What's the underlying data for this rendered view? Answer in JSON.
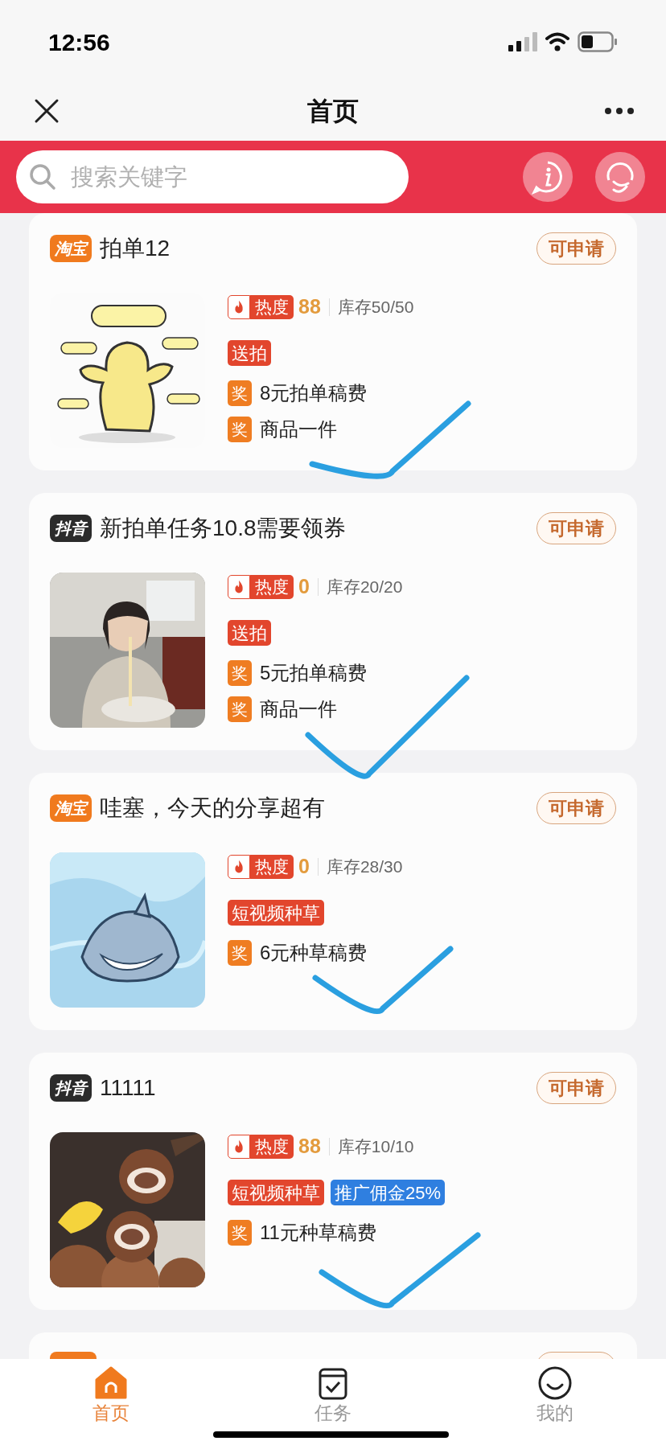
{
  "status_bar": {
    "time": "12:56"
  },
  "nav_bar": {
    "title": "首页"
  },
  "search": {
    "placeholder": "搜索关键字"
  },
  "tasks": [
    {
      "kind": "taobao",
      "platform_label": "淘宝",
      "title": "拍单12",
      "action": "可申请",
      "heat_label": "热度",
      "heat": "88",
      "stock": "库存50/50",
      "tags": [
        {
          "text": "送拍",
          "color": "#e2462d"
        }
      ],
      "rewards": [
        {
          "badge": "奖",
          "text": "8元拍单稿费"
        },
        {
          "badge": "奖",
          "text": "商品一件"
        }
      ]
    },
    {
      "kind": "douyin",
      "platform_label": "抖音",
      "title": "新拍单任务10.8需要领券",
      "action": "可申请",
      "heat_label": "热度",
      "heat": "0",
      "stock": "库存20/20",
      "tags": [
        {
          "text": "送拍",
          "color": "#e2462d"
        }
      ],
      "rewards": [
        {
          "badge": "奖",
          "text": "5元拍单稿费"
        },
        {
          "badge": "奖",
          "text": "商品一件"
        }
      ]
    },
    {
      "kind": "taobao",
      "platform_label": "淘宝",
      "title": "哇塞，今天的分享超有",
      "action": "可申请",
      "heat_label": "热度",
      "heat": "0",
      "stock": "库存28/30",
      "tags": [
        {
          "text": "短视频种草",
          "color": "#e2462d"
        }
      ],
      "rewards": [
        {
          "badge": "奖",
          "text": "6元种草稿费"
        }
      ]
    },
    {
      "kind": "douyin",
      "platform_label": "抖音",
      "title": "11111",
      "action": "可申请",
      "heat_label": "热度",
      "heat": "88",
      "stock": "库存10/10",
      "tags": [
        {
          "text": "短视频种草",
          "color": "#e2462d"
        },
        {
          "text": "推广佣金25%",
          "color": "#2f7fe0"
        }
      ],
      "rewards": [
        {
          "badge": "奖",
          "text": "11元种草稿费"
        }
      ]
    }
  ],
  "tab_bar": [
    {
      "label": "首页",
      "selected": true
    },
    {
      "label": "任务",
      "selected": false
    },
    {
      "label": "我的",
      "selected": false
    }
  ]
}
